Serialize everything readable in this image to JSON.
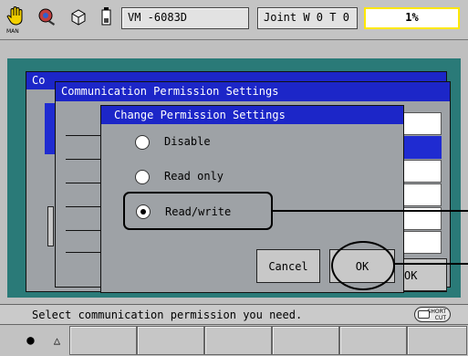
{
  "toolbar": {
    "mode_label": "MAN",
    "robot": "VM   -6083D",
    "coord": "Joint  W 0 T 0",
    "speed": "1%",
    "icons": [
      "hand-icon",
      "teach-robot-icon",
      "cube-icon",
      "battery-icon"
    ]
  },
  "back_window": {
    "title_fragment": "Co"
  },
  "comm_dialog": {
    "title": "Communication Permission Settings",
    "ok_label": "OK"
  },
  "change_dialog": {
    "title": "Change Permission Settings",
    "options": [
      {
        "label": "Disable",
        "selected": false
      },
      {
        "label": "Read only",
        "selected": false
      },
      {
        "label": "Read/write",
        "selected": true
      }
    ],
    "cancel_label": "Cancel",
    "ok_label": "OK"
  },
  "status": {
    "message": "Select communication permission you need.",
    "shortcut_label": "SHORT CUT"
  },
  "fkeys": {
    "f1_symbol": "●",
    "f2_symbol": "△"
  },
  "colors": {
    "title_blue": "#1c26c8",
    "teal": "#2a7a78",
    "speed_yellow": "#ffff00",
    "panel_gray": "#9ea2a6"
  }
}
